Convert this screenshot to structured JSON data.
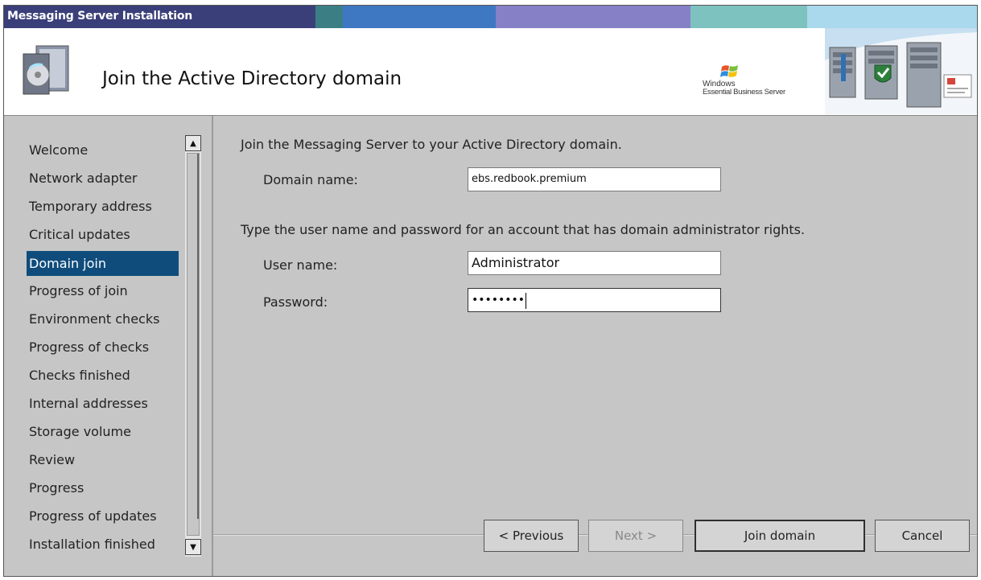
{
  "window": {
    "title": "Messaging Server Installation",
    "title_colors": [
      "#3a3f7a",
      "#3b7f84",
      "#3e78c2",
      "#8680c7",
      "#7ec2c0",
      "#aad8ec"
    ]
  },
  "header": {
    "title": "Join the Active Directory domain",
    "brand_line1": "Windows",
    "brand_line2": "Essential Business Server"
  },
  "sidebar": {
    "items": [
      {
        "label": "Welcome"
      },
      {
        "label": "Network adapter"
      },
      {
        "label": "Temporary address"
      },
      {
        "label": "Critical updates"
      },
      {
        "label": "Domain join",
        "selected": true
      },
      {
        "label": "Progress of join"
      },
      {
        "label": "Environment checks"
      },
      {
        "label": "Progress of checks"
      },
      {
        "label": "Checks finished"
      },
      {
        "label": "Internal addresses"
      },
      {
        "label": "Storage volume"
      },
      {
        "label": "Review"
      },
      {
        "label": "Progress"
      },
      {
        "label": "Progress of updates"
      },
      {
        "label": "Installation finished"
      }
    ],
    "selected_color": "#0f4c7c"
  },
  "main": {
    "intro": "Join the Messaging Server to your Active Directory domain.",
    "domain_label": "Domain name:",
    "domain_value": "ebs.redbook.premium",
    "credentials_intro": "Type the user name and password for an account that has domain administrator rights.",
    "user_label": "User name:",
    "user_value": "Administrator",
    "password_label": "Password:",
    "password_value": "••••••••"
  },
  "buttons": {
    "previous": "< Previous",
    "next": "Next >",
    "join": "Join domain",
    "cancel": "Cancel"
  }
}
